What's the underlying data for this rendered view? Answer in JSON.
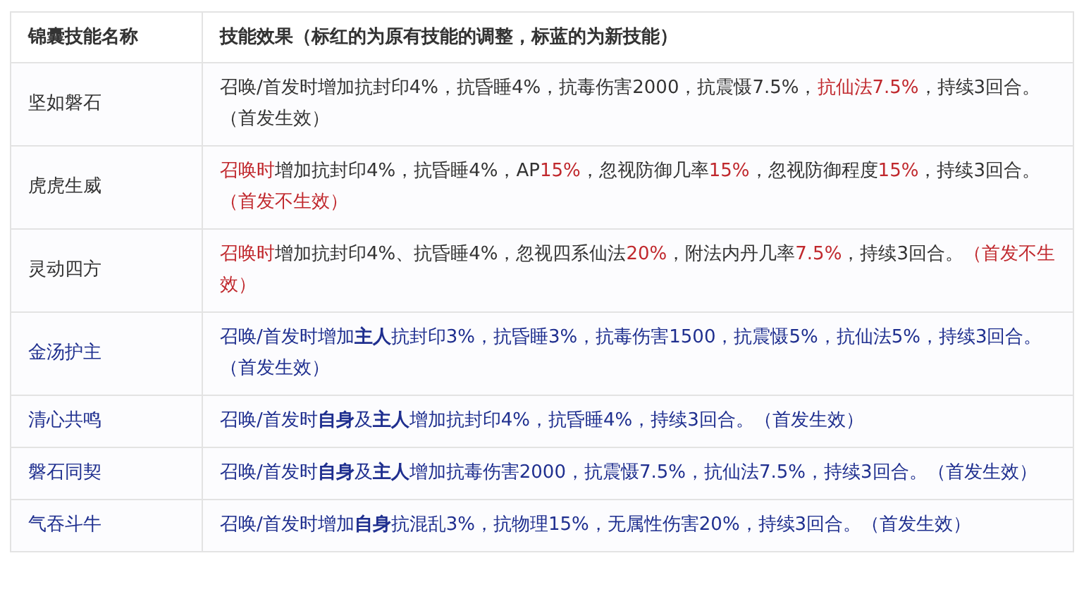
{
  "table": {
    "columns": [
      "锦囊技能名称",
      "技能效果（标红的为原有技能的调整，标蓝的为新技能）"
    ],
    "rows": [
      {
        "name": "坚如磐石",
        "color": "#333333",
        "effect": [
          {
            "text": "召唤/首发时增加抗封印4%，抗昏睡4%，抗毒伤害2000，抗震慑7.5%，",
            "color": "#333333"
          },
          {
            "text": "抗仙法7.5%",
            "color": "#c0282d"
          },
          {
            "text": "，持续3回合。（首发生效）",
            "color": "#333333"
          }
        ]
      },
      {
        "name": "虎虎生威",
        "color": "#333333",
        "effect": [
          {
            "text": "召唤时",
            "color": "#c0282d"
          },
          {
            "text": "增加抗封印4%，抗昏睡4%，AP",
            "color": "#333333"
          },
          {
            "text": "15%",
            "color": "#c0282d"
          },
          {
            "text": "，忽视防御几率",
            "color": "#333333"
          },
          {
            "text": "15%",
            "color": "#c0282d"
          },
          {
            "text": "，忽视防御程度",
            "color": "#333333"
          },
          {
            "text": "15%",
            "color": "#c0282d"
          },
          {
            "text": "，持续3回合。",
            "color": "#333333"
          },
          {
            "text": "（首发不生效）",
            "color": "#c0282d"
          }
        ]
      },
      {
        "name": "灵动四方",
        "color": "#333333",
        "effect": [
          {
            "text": "召唤时",
            "color": "#c0282d"
          },
          {
            "text": "增加抗封印4%、抗昏睡4%，忽视四系仙法",
            "color": "#333333"
          },
          {
            "text": "20%",
            "color": "#c0282d"
          },
          {
            "text": "，附法内丹几率",
            "color": "#333333"
          },
          {
            "text": "7.5%",
            "color": "#c0282d"
          },
          {
            "text": "，持续3回合。",
            "color": "#333333"
          },
          {
            "text": "（首发不生效）",
            "color": "#c0282d"
          }
        ]
      },
      {
        "name": "金汤护主",
        "color": "#1f2f8f",
        "effect": [
          {
            "text": "召唤/首发时增加**主人**抗封印3%，抗昏睡3%，抗毒伤害1500，抗震慑5%，抗仙法5%，持续3回合。（首发生效）",
            "color": "#1f2f8f"
          }
        ]
      },
      {
        "name": "清心共鸣",
        "color": "#1f2f8f",
        "effect": [
          {
            "text": "召唤/首发时**自身**及**主人**增加抗封印4%，抗昏睡4%，持续3回合。（首发生效）",
            "color": "#1f2f8f"
          }
        ]
      },
      {
        "name": "磐石同契",
        "color": "#1f2f8f",
        "effect": [
          {
            "text": "召唤/首发时**自身**及**主人**增加抗毒伤害2000，抗震慑7.5%，抗仙法7.5%，持续3回合。（首发生效）",
            "color": "#1f2f8f"
          }
        ]
      },
      {
        "name": "气吞斗牛",
        "color": "#1f2f8f",
        "effect": [
          {
            "text": "召唤/首发时增加**自身**抗混乱3%，抗物理15%，无属性伤害20%，持续3回合。（首发生效）",
            "color": "#1f2f8f"
          }
        ]
      }
    ]
  }
}
